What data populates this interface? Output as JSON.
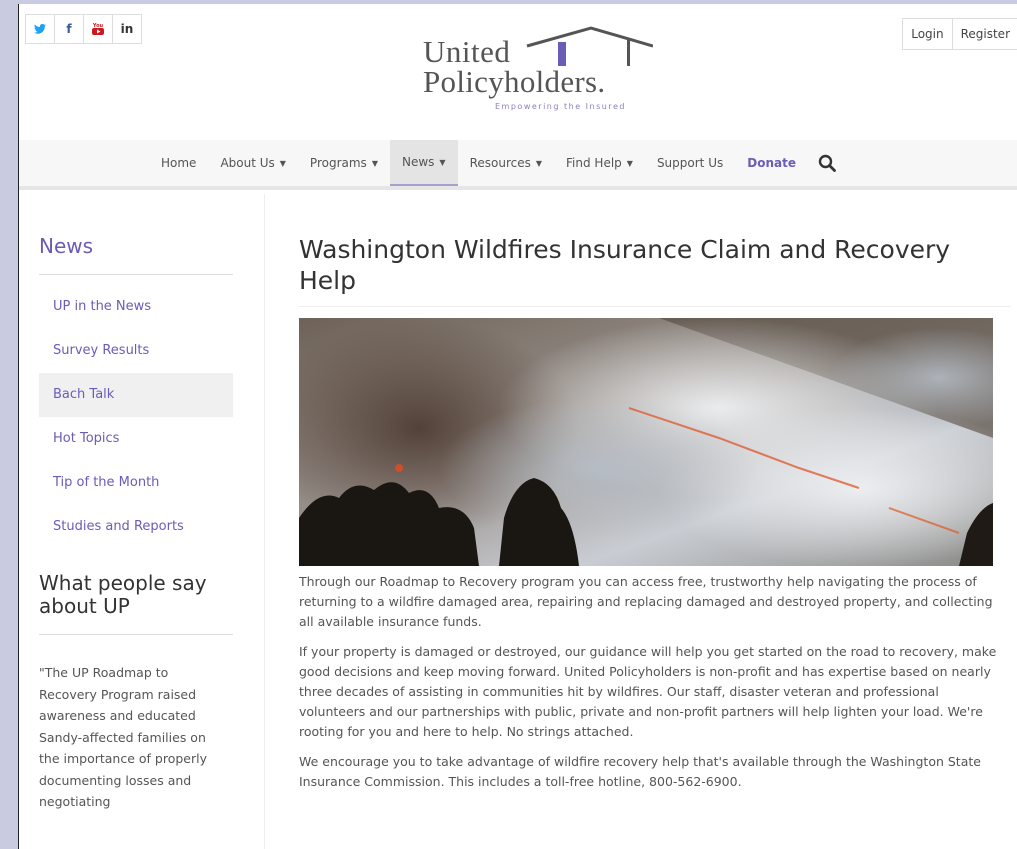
{
  "social": {
    "twitter": "t",
    "facebook": "f",
    "youtube": "▶",
    "linkedin": "in"
  },
  "auth": {
    "login": "Login",
    "register": "Register"
  },
  "logo": {
    "line1": "United",
    "line2": "Policyholders.",
    "tagline": "Empowering the Insured"
  },
  "nav": {
    "items": [
      {
        "label": "Home",
        "caret": false
      },
      {
        "label": "About Us",
        "caret": true
      },
      {
        "label": "Programs",
        "caret": true
      },
      {
        "label": "News",
        "caret": true
      },
      {
        "label": "Resources",
        "caret": true
      },
      {
        "label": "Find Help",
        "caret": true
      },
      {
        "label": "Support Us",
        "caret": false
      },
      {
        "label": "Donate",
        "caret": false
      }
    ],
    "active": "News",
    "caret_glyph": "▼",
    "search_icon": "search-icon"
  },
  "sidebar": {
    "title": "News",
    "items": [
      "UP in the News",
      "Survey Results",
      "Bach Talk",
      "Hot Topics",
      "Tip of the Month",
      "Studies and Reports"
    ],
    "active_item": "Bach Talk",
    "says_title": "What people say about UP",
    "quote": "\"The UP Roadmap to Recovery Program raised awareness and educated Sandy-affected families on the importance of properly documenting losses and negotiating"
  },
  "main": {
    "title": "Washington Wildfires Insurance Claim and Recovery Help",
    "paragraphs": [
      "Through our Roadmap to Recovery program you can access free, trustworthy help navigating the process of returning to a wildfire damaged area, repairing and replacing damaged and destroyed property, and collecting all available insurance funds.",
      "If your property is damaged or destroyed, our guidance will help you get started on the road to recovery, make good decisions and keep moving forward. United Policyholders is non-profit and has expertise based on nearly three decades of assisting in communities hit by wildfires. Our staff, disaster veteran and professional volunteers and our partnerships with public, private and non-profit partners will help lighten your load. We're rooting for you and here to help. No strings attached.",
      "We encourage you to take advantage of wildfire recovery help that's available through the Washington State Insurance Commission. This includes a toll-free hotline, 800-562-6900."
    ]
  },
  "colors": {
    "accent": "#6b5cb5",
    "twitter": "#1da1f2",
    "facebook": "#3b5998",
    "youtube": "#cc181e",
    "linkedin": "#0077b5"
  }
}
